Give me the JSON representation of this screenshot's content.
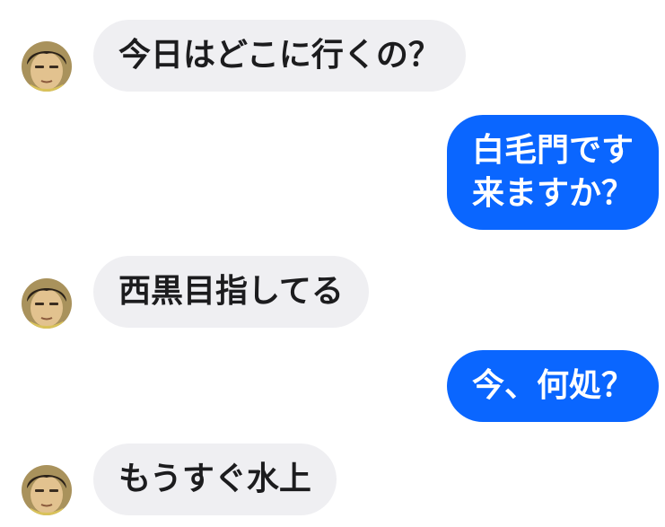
{
  "conversation": {
    "messages": [
      {
        "direction": "incoming",
        "lines": [
          "今日はどこに行くの？"
        ]
      },
      {
        "direction": "outgoing",
        "lines": [
          "白毛門です",
          "来ますか？"
        ]
      },
      {
        "direction": "incoming",
        "lines": [
          "西黒目指してる"
        ]
      },
      {
        "direction": "outgoing",
        "lines": [
          "今、何処？"
        ]
      },
      {
        "direction": "incoming",
        "lines": [
          "もうすぐ水上"
        ]
      }
    ]
  },
  "colors": {
    "incoming_bubble": "#efeff2",
    "incoming_text": "#1c1c1e",
    "outgoing_bubble": "#0a66ff",
    "outgoing_text": "#ffffff"
  },
  "icons": {
    "contact_avatar": "avatar"
  }
}
